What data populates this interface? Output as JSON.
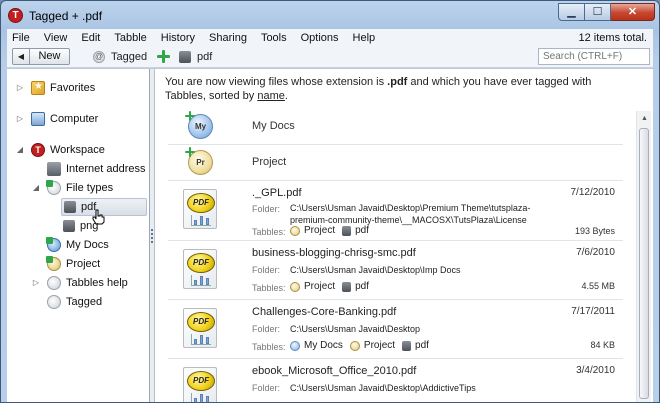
{
  "window": {
    "title": "Tagged  +  .pdf",
    "min_glyph": "▁",
    "max_glyph": "☐",
    "close_glyph": "✕",
    "app_icon_glyph": "T"
  },
  "menu": [
    "File",
    "View",
    "Edit",
    "Tabble",
    "History",
    "Sharing",
    "Tools",
    "Options",
    "Help"
  ],
  "items_count": "12 items total.",
  "toolbar": {
    "back_glyph": "◀",
    "new_label": "New",
    "breadcrumb": [
      "Tagged",
      "pdf"
    ],
    "search_placeholder": "Search (CTRL+F)"
  },
  "sidebar": {
    "favorites": "Favorites",
    "computer": "Computer",
    "workspace": "Workspace",
    "internet_address": "Internet address",
    "file_types": "File types",
    "pdf": "pdf",
    "png": "png",
    "my_docs": "My Docs",
    "project": "Project",
    "tables_help": "Tabbles help",
    "tagged": "Tagged",
    "collapsed_arrow": "▷",
    "expanded_arrow": "◢"
  },
  "main": {
    "intro_pre": "You are now viewing files whose extension is ",
    "intro_ext": ".pdf",
    "intro_mid": "  and  which you have ever tagged with Tabbles, sorted by ",
    "intro_link": "name",
    "intro_end": ".",
    "tags": [
      {
        "name": "My Docs",
        "abbr": "My"
      },
      {
        "name": "Project",
        "abbr": "Pr"
      }
    ],
    "folder_label": "Folder:",
    "tabbles_label": "Tabbles:",
    "pdf_badge": "PDF",
    "files": [
      {
        "name": "._GPL.pdf",
        "date": "7/12/2010",
        "folder": "C:\\Users\\Usman Javaid\\Desktop\\Premium Theme\\tutsplaza-premium-community-theme\\__MACOSX\\TutsPlaza\\License",
        "size": "193 Bytes",
        "tag1": "Project",
        "tag2": "pdf"
      },
      {
        "name": "business-blogging-chrisg-smc.pdf",
        "date": "7/6/2010",
        "folder": "C:\\Users\\Usman Javaid\\Desktop\\Imp Docs",
        "size": "4.55 MB",
        "tag1": "Project",
        "tag2": "pdf"
      },
      {
        "name": "Challenges-Core-Banking.pdf",
        "date": "7/17/2011",
        "folder": "C:\\Users\\Usman Javaid\\Desktop",
        "size": "84 KB",
        "tag1": "My Docs",
        "tag2": "Project",
        "tag3": "pdf"
      },
      {
        "name": "ebook_Microsoft_Office_2010.pdf",
        "date": "3/4/2010",
        "folder": "C:\\Users\\Usman Javaid\\Desktop\\AddictiveTips"
      }
    ],
    "scroll_up_glyph": "▲"
  }
}
